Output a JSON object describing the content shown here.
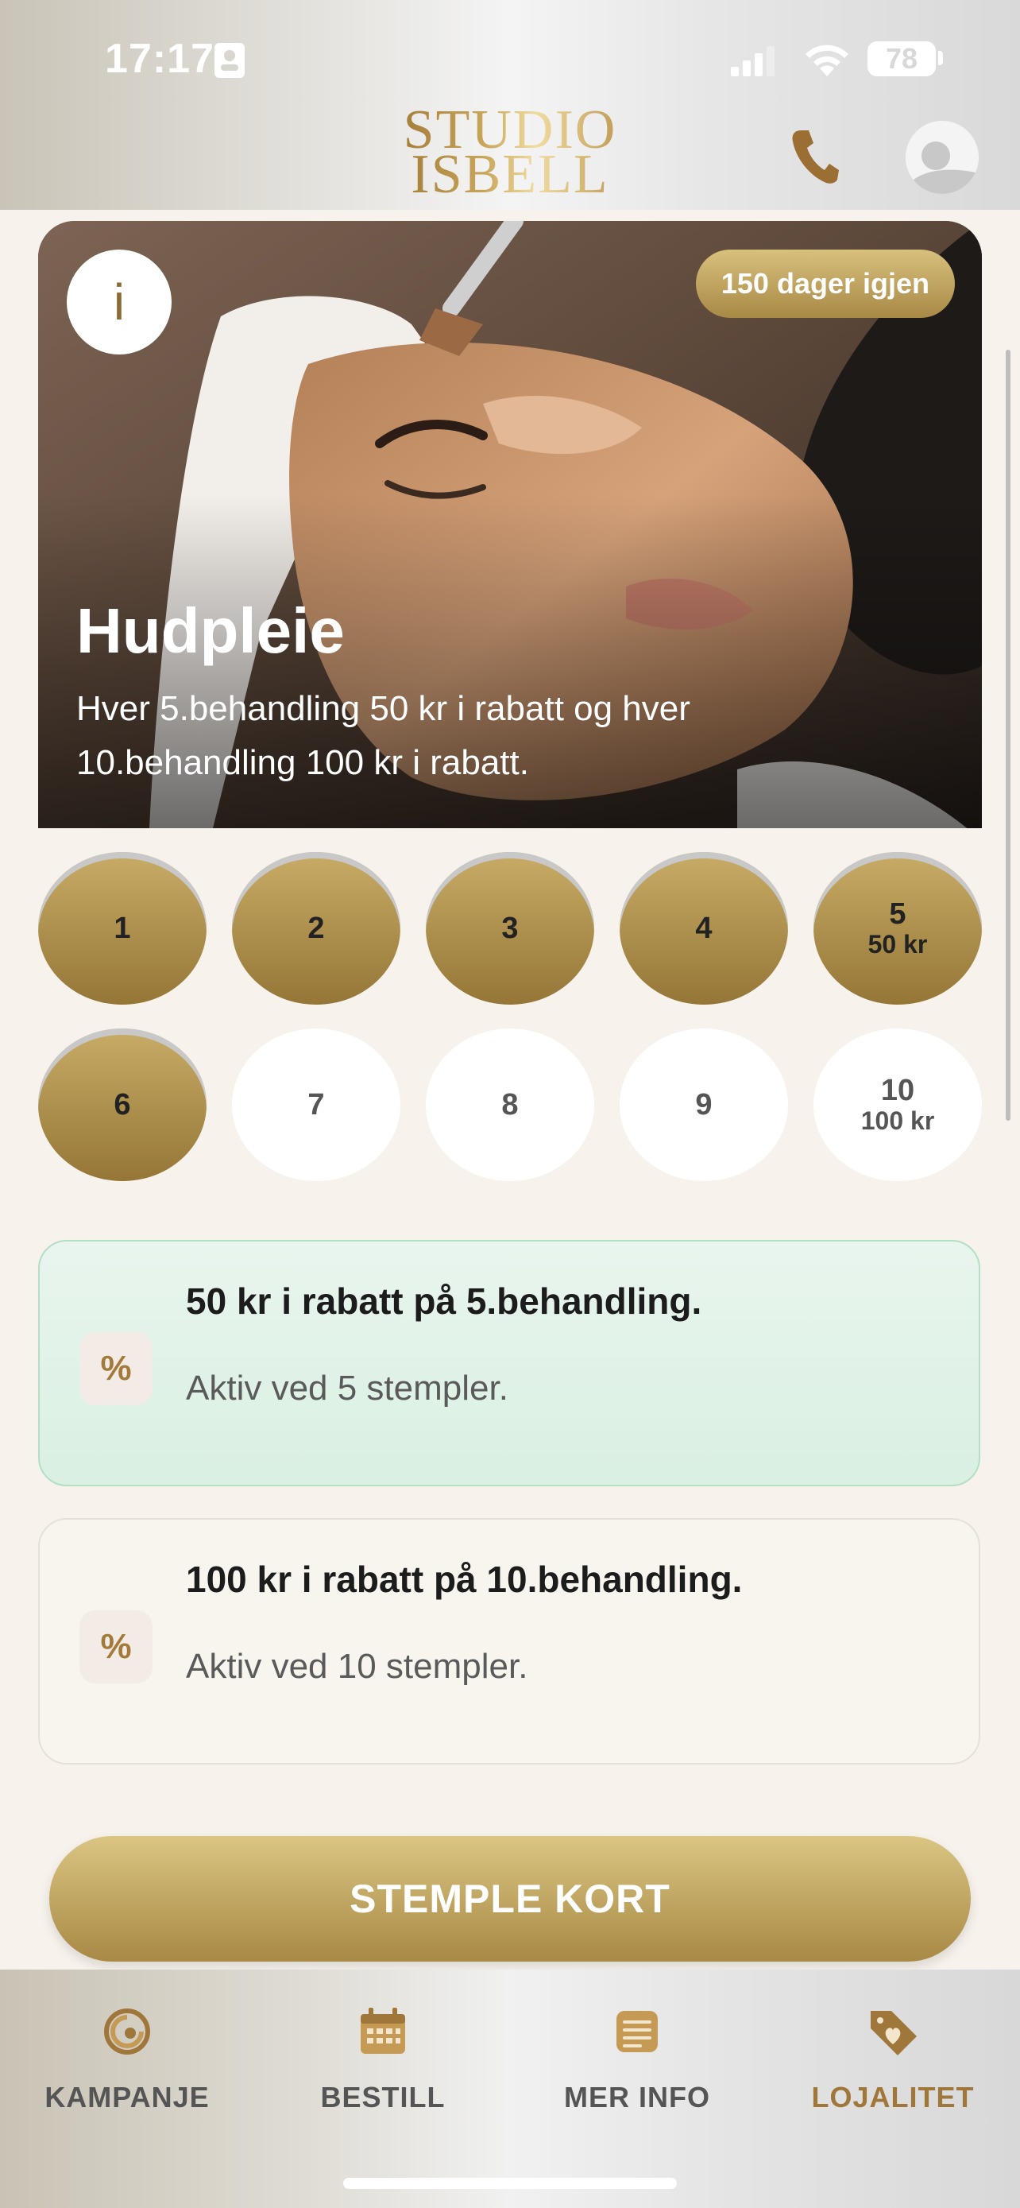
{
  "status_bar": {
    "time": "17:17",
    "battery": "78"
  },
  "header": {
    "logo_line1": "STUDIO",
    "logo_line2": "ISBELL"
  },
  "hero": {
    "info_label": "i",
    "days_left": "150 dager igjen",
    "title": "Hudpleie",
    "description": "Hver 5.behandling 50 kr i rabatt og hver 10.behandling 100 kr i rabatt."
  },
  "stamps": [
    {
      "number": "1",
      "reward": "",
      "filled": true
    },
    {
      "number": "2",
      "reward": "",
      "filled": true
    },
    {
      "number": "3",
      "reward": "",
      "filled": true
    },
    {
      "number": "4",
      "reward": "",
      "filled": true
    },
    {
      "number": "5",
      "reward": "50 kr",
      "filled": true
    },
    {
      "number": "6",
      "reward": "",
      "filled": true
    },
    {
      "number": "7",
      "reward": "",
      "filled": false
    },
    {
      "number": "8",
      "reward": "",
      "filled": false
    },
    {
      "number": "9",
      "reward": "",
      "filled": false
    },
    {
      "number": "10",
      "reward": "100 kr",
      "filled": false
    }
  ],
  "rewards": [
    {
      "icon": "%",
      "title": "50 kr i rabatt på 5.behandling.",
      "subtitle": "Aktiv ved 5 stempler."
    },
    {
      "icon": "%",
      "title": "100 kr i rabatt på 10.behandling.",
      "subtitle": "Aktiv ved 10 stempler."
    }
  ],
  "cta": {
    "label": "STEMPLE KORT"
  },
  "tabs": [
    {
      "label": "KAMPANJE",
      "icon": "spiral-icon",
      "active": false
    },
    {
      "label": "BESTILL",
      "icon": "calendar-icon",
      "active": false
    },
    {
      "label": "MER INFO",
      "icon": "document-icon",
      "active": false
    },
    {
      "label": "LOJALITET",
      "icon": "heart-tag-icon",
      "active": true
    }
  ],
  "colors": {
    "gold": "#a88945",
    "gold_light": "#d8c07d",
    "active_green": "#d9f0e2",
    "background": "#f7f2ec"
  }
}
